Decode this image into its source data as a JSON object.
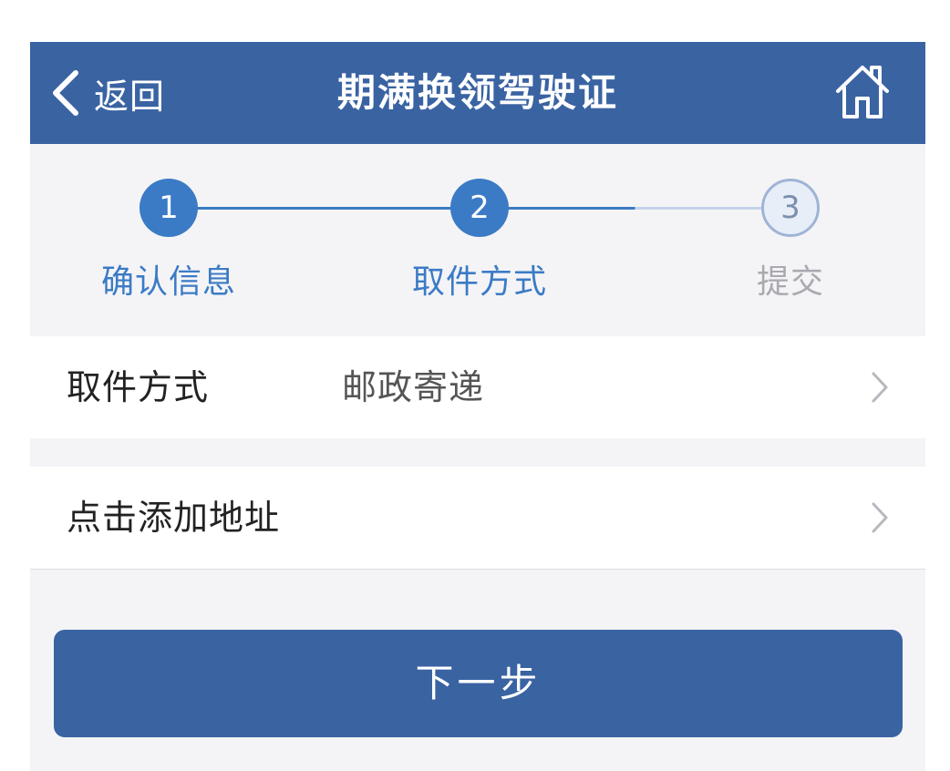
{
  "navbar": {
    "back_label": "返回",
    "title": "期满换领驾驶证",
    "background_color": "#3a63a2"
  },
  "steps": [
    {
      "number": "1",
      "label": "确认信息",
      "state": "done"
    },
    {
      "number": "2",
      "label": "取件方式",
      "state": "current"
    },
    {
      "number": "3",
      "label": "提交",
      "state": "pending"
    }
  ],
  "form": {
    "pickup": {
      "label": "取件方式",
      "value": "邮政寄递"
    },
    "address": {
      "label": "点击添加地址"
    }
  },
  "next_button": {
    "label": "下一步"
  },
  "icons": {
    "back": "chevron-left-icon",
    "home": "home-icon",
    "row": "chevron-right-icon"
  },
  "colors": {
    "accent": "#3b7bc5",
    "primary": "#3a63a2",
    "pending": "#a9a9b0"
  }
}
